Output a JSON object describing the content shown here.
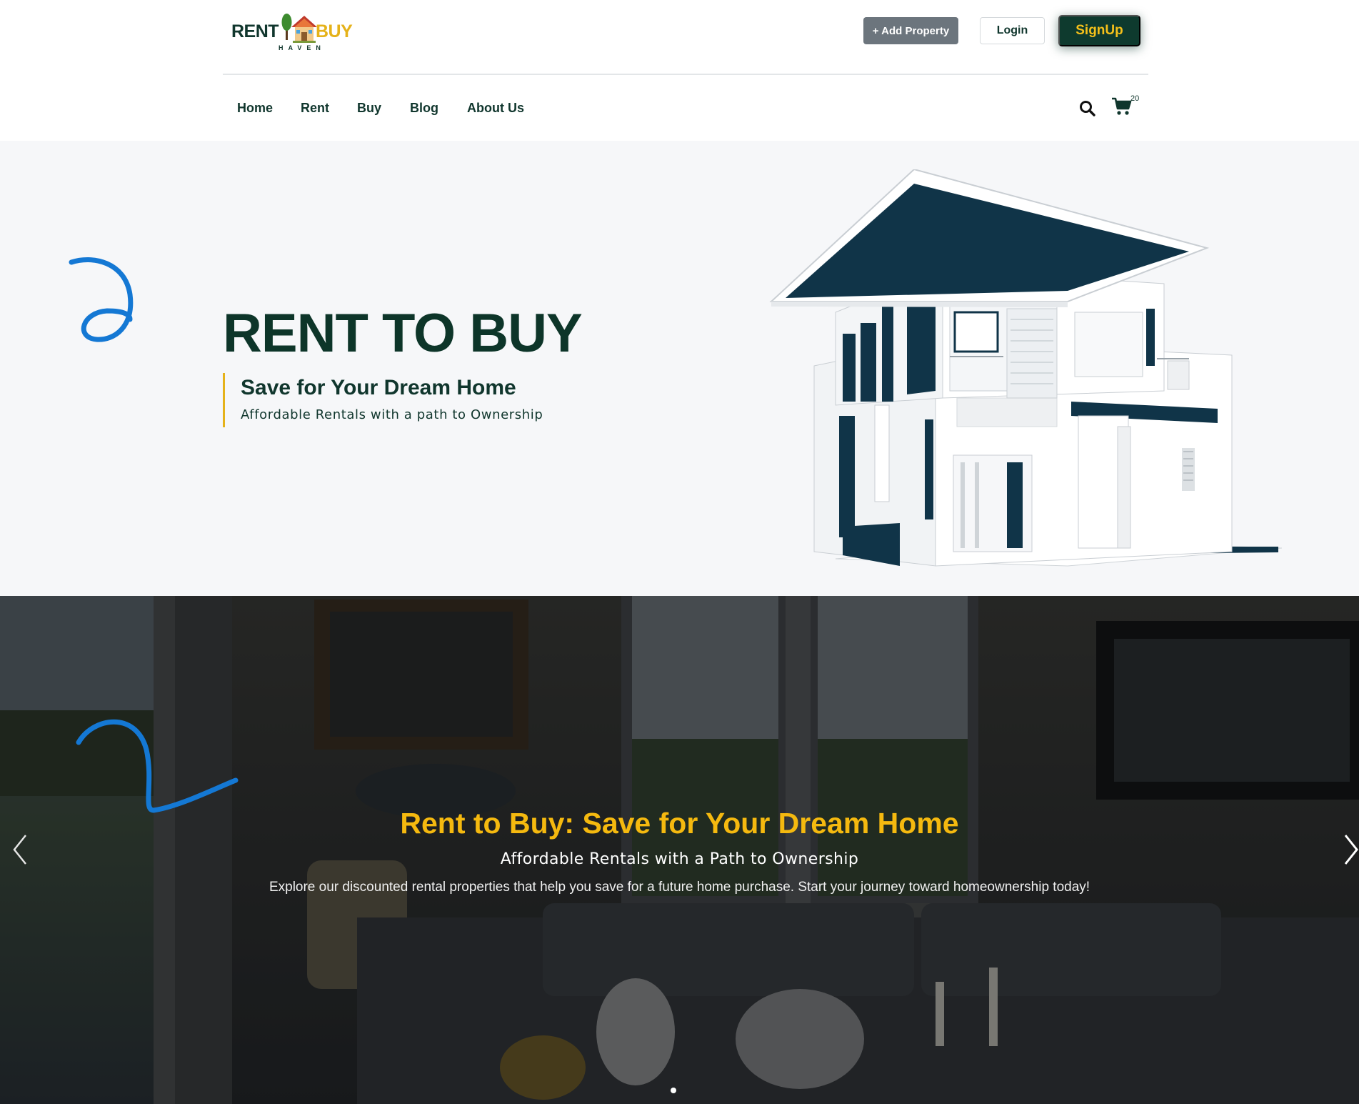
{
  "header": {
    "logo": {
      "word_rent": "RENT",
      "word_buy": "BUY",
      "word_haven": "HAVEN"
    },
    "add_property_label": "+ Add Property",
    "login_label": "Login",
    "signup_label": "SignUp"
  },
  "nav": {
    "items": [
      {
        "label": "Home"
      },
      {
        "label": "Rent"
      },
      {
        "label": "Buy"
      },
      {
        "label": "Blog"
      },
      {
        "label": "About Us"
      }
    ],
    "cart_count": "20",
    "icons": {
      "search": "search-icon",
      "cart": "cart-icon"
    }
  },
  "hero": {
    "title": "RENT TO BUY",
    "subtitle": "Save for Your Dream Home",
    "tagline": "Affordable Rentals with a path to Ownership"
  },
  "carousel": {
    "title": "Rent to Buy: Save for Your Dream Home",
    "subtitle": "Affordable Rentals with a Path to Ownership",
    "description": "Explore our discounted rental properties that help you save for a future home purchase. Start your journey toward homeownership today!",
    "active_slide": 1,
    "slide_count": 1,
    "icons": {
      "prev": "chevron-left-icon",
      "next": "chevron-right-icon"
    }
  },
  "colors": {
    "brand_dark": "#0e3a2e",
    "brand_gold": "#e5b21a",
    "carousel_title": "#f5b90f",
    "add_property_bg": "#6c757d",
    "annotation_blue": "#1478d4",
    "hero_bg": "#f6f7f9"
  }
}
